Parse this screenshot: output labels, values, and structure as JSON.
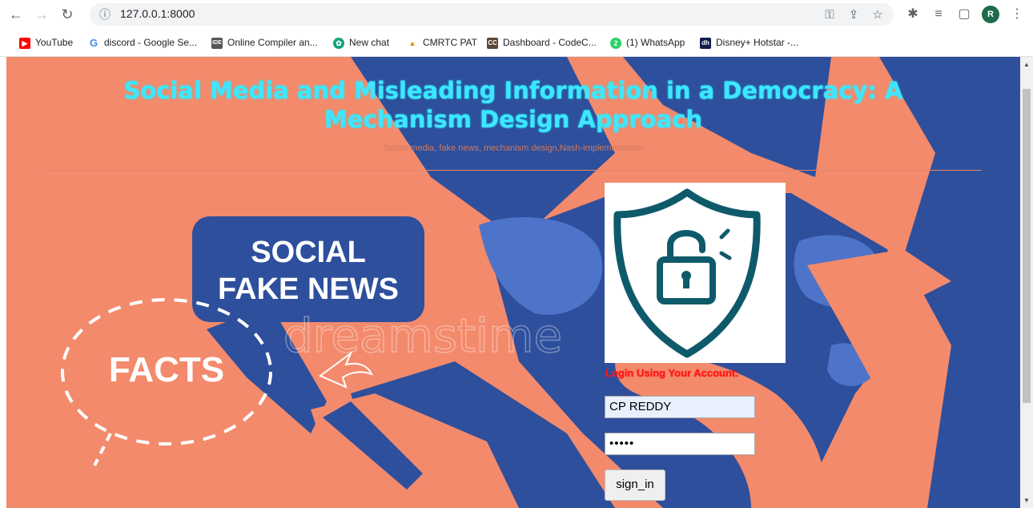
{
  "browser": {
    "url": "127.0.0.1:8000",
    "profile_initial": "R",
    "icons": [
      "back-icon",
      "forward-icon",
      "reload-icon",
      "info-icon",
      "key-icon",
      "share-icon",
      "star-icon",
      "extensions-icon",
      "media-icon",
      "sidepanel-icon",
      "menu-icon"
    ]
  },
  "bookmarks": [
    {
      "label": "YouTube",
      "icon": "youtube-icon"
    },
    {
      "label": "discord - Google Se...",
      "icon": "google-icon"
    },
    {
      "label": "Online Compiler an...",
      "icon": "ide-icon"
    },
    {
      "label": "New chat",
      "icon": "chatgpt-icon"
    },
    {
      "label": "CMRTC PAT",
      "icon": "cmrtc-icon"
    },
    {
      "label": "Dashboard - CodeC...",
      "icon": "codechef-icon"
    },
    {
      "label": "(1) WhatsApp",
      "icon": "whatsapp-icon"
    },
    {
      "label": "Disney+ Hotstar -...",
      "icon": "hotstar-icon"
    }
  ],
  "page": {
    "title": "Social Media and Misleading Information in a Democracy: A Mechanism Design Approach",
    "subtitle": "Social media, fake news, mechanism design,Nash-implementation",
    "background_texts": {
      "bubble_line1": "SOCIAL",
      "bubble_line2": "FAKE NEWS",
      "facts": "FACTS",
      "watermark": "dreamstime"
    },
    "login": {
      "label": "Login Using Your Account:",
      "username_value": "CP REDDY",
      "password_value": "•••••",
      "button_label": "sign_in"
    }
  },
  "colors": {
    "page_bg": "#f38a6c",
    "map_blue": "#2e4f9c",
    "title": "#3ee7ff",
    "login_label": "#ff1a1a",
    "lock_icon": "#0e5a6b"
  }
}
